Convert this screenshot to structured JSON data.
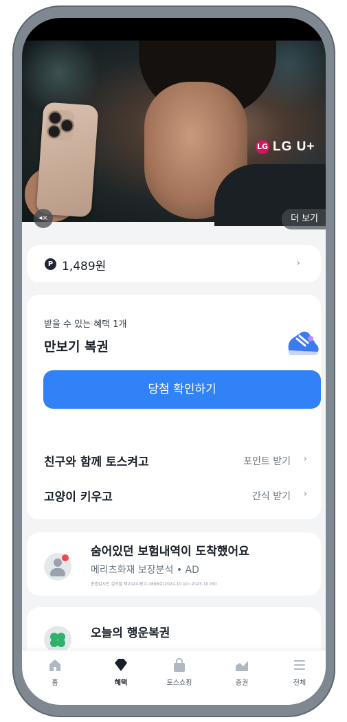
{
  "banner": {
    "brand_logo": "LG U+",
    "brand_mark": "LG",
    "mute_icon": "◂×",
    "more_label": "더 보기"
  },
  "points": {
    "icon_letter": "P",
    "value": "1,489원",
    "chevron": "›"
  },
  "benefit": {
    "subtitle": "받을 수 있는 혜택 1개",
    "title": "만보기 복권",
    "icon": "sneaker-icon",
    "cta_label": "당첨 확인하기",
    "rows": [
      {
        "label": "친구와 함께 토스켜고",
        "action": "포인트 받기",
        "chevron": "›"
      },
      {
        "label": "고양이 키우고",
        "action": "간식 받기",
        "chevron": "›"
      }
    ]
  },
  "ad": {
    "icon": "user-icon",
    "title": "숨어있던 보험내역이 도착했어요",
    "subtitle": "메리츠화재 보장분석 • AD",
    "fine_print": "준법감시인 심의필 제2024-광고-1696호(2024.10.10~2025.10.09)"
  },
  "lucky": {
    "icon": "clover-icon",
    "title": "오늘의 행운복권"
  },
  "tabbar": {
    "tabs": [
      {
        "id": "home",
        "label": "홈",
        "icon": "home-icon",
        "active": false
      },
      {
        "id": "benefit",
        "label": "혜택",
        "icon": "gem-icon",
        "active": true
      },
      {
        "id": "shopping",
        "label": "토스쇼핑",
        "icon": "shopping-bag-icon",
        "active": false
      },
      {
        "id": "stock",
        "label": "증권",
        "icon": "chart-icon",
        "active": false
      },
      {
        "id": "all",
        "label": "전체",
        "icon": "menu-icon",
        "active": false
      }
    ]
  },
  "colors": {
    "accent": "#3182f6",
    "background": "#f2f4f6",
    "card": "#ffffff",
    "text_primary": "#191f28",
    "text_secondary": "#6b7684",
    "brand_lg": "#d6145f",
    "badge_red": "#f04452"
  }
}
